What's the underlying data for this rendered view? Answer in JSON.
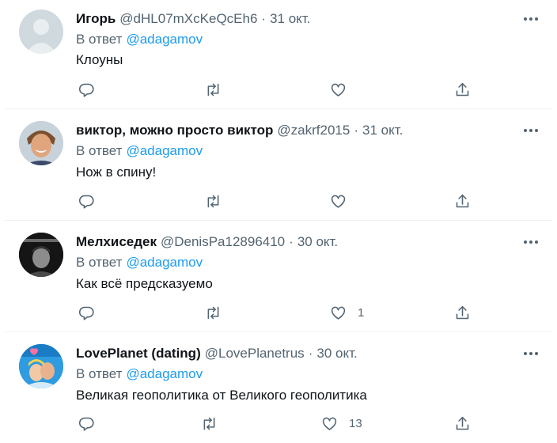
{
  "tweets": [
    {
      "name": "Игорь",
      "handle": "@dHL07mXcKeQcEh6",
      "separator": "·",
      "date": "31 окт.",
      "reply_prefix": "В ответ",
      "reply_to": "@adagamov",
      "text": "Клоуны",
      "like_count": "",
      "avatar": "default-avatar"
    },
    {
      "name": "виктор, можно просто виктор",
      "handle": "@zakrf2015",
      "separator": "·",
      "date": "31 окт.",
      "reply_prefix": "В ответ",
      "reply_to": "@adagamov",
      "text": "Нож в спину!",
      "like_count": "",
      "avatar": "photo-smiling-man"
    },
    {
      "name": "Мелхиседек",
      "handle": "@DenisPa12896410",
      "separator": "·",
      "date": "30 окт.",
      "reply_prefix": "В ответ",
      "reply_to": "@adagamov",
      "text": "Как всё предсказуемо",
      "like_count": "1",
      "avatar": "photo-dark-portrait"
    },
    {
      "name": "LovePlanet (dating)",
      "handle": "@LovePlanetrus",
      "separator": "·",
      "date": "30 окт.",
      "reply_prefix": "В ответ",
      "reply_to": "@adagamov",
      "text": "Великая геополитика от Великого геополитика",
      "like_count": "13",
      "avatar": "loveplanet-logo"
    }
  ],
  "colors": {
    "text": "#0f1419",
    "muted": "#536471",
    "link": "#1d9bf0",
    "divider": "#eff3f4"
  }
}
